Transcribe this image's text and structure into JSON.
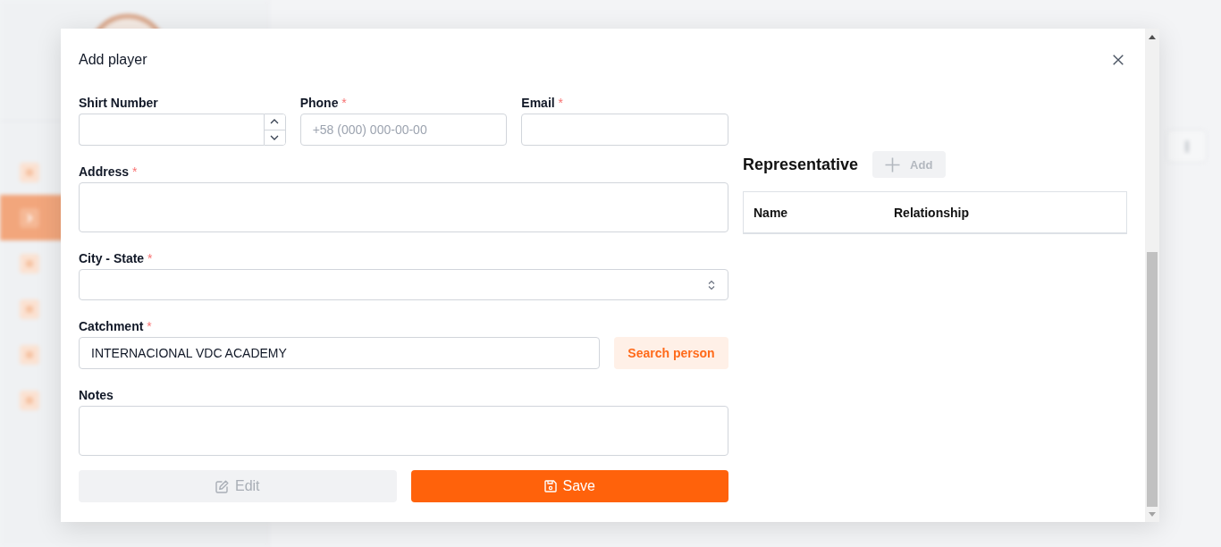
{
  "background": {
    "sidebar": {
      "items": [
        {
          "selected": false
        },
        {
          "selected": true
        },
        {
          "selected": false
        },
        {
          "selected": false
        },
        {
          "selected": false
        },
        {
          "selected": false
        }
      ]
    }
  },
  "dialog": {
    "title": "Add player",
    "form": {
      "rows": [
        {
          "fields": [
            {
              "kind": "number",
              "label": "Shirt Number"
            },
            {
              "kind": "text",
              "label": "Phone",
              "required_mark": "*",
              "placeholder": "+58 (000) 000-00-00"
            },
            {
              "kind": "text",
              "label": "Email",
              "required_mark": "*"
            }
          ]
        },
        {
          "fields": [
            {
              "kind": "textarea",
              "label": "Address",
              "required_mark": "*"
            }
          ]
        },
        {
          "fields": [
            {
              "kind": "select",
              "label": "City - State",
              "required_mark": "*"
            }
          ]
        },
        {
          "fields": [
            {
              "kind": "text",
              "label": "Catchment",
              "required_mark": "*",
              "value": "INTERNACIONAL VDC ACADEMY",
              "action": {
                "label": "Search person"
              }
            }
          ]
        },
        {
          "fields": [
            {
              "kind": "textarea",
              "label": "Notes"
            }
          ]
        }
      ]
    },
    "actions": [
      {
        "kind": "edit",
        "label": "Edit",
        "disabled": true
      },
      {
        "kind": "save",
        "label": "Save",
        "disabled": false
      }
    ],
    "representative": {
      "title": "Representative",
      "add_button": {
        "label": "Add",
        "disabled": true
      },
      "table": {
        "columns": [
          "Name",
          "Relationship"
        ]
      }
    }
  }
}
